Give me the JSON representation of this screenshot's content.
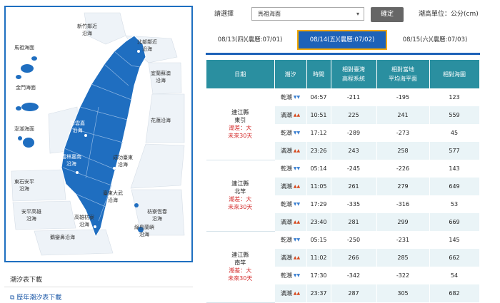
{
  "map": {
    "zones": [
      {
        "name": "新竹鄰近",
        "sub": "沿海"
      },
      {
        "name": "馬祖海面",
        "sub": ""
      },
      {
        "name": "北部鄰近",
        "sub": "沿海"
      },
      {
        "name": "宜蘭蘇澳",
        "sub": "沿海"
      },
      {
        "name": "金門海面",
        "sub": ""
      },
      {
        "name": "彰雲嘉",
        "sub": "沿海"
      },
      {
        "name": "花蓮沿海",
        "sub": ""
      },
      {
        "name": "澎湖海面",
        "sub": ""
      },
      {
        "name": "雲林嘉南",
        "sub": "沿海"
      },
      {
        "name": "成功臺東",
        "sub": "沿海"
      },
      {
        "name": "東石安平",
        "sub": "沿海"
      },
      {
        "name": "安平高雄",
        "sub": "沿海"
      },
      {
        "name": "臺東大武",
        "sub": "沿海"
      },
      {
        "name": "高雄枋寮",
        "sub": "沿海"
      },
      {
        "name": "枋寮恆春",
        "sub": "沿海"
      },
      {
        "name": "綠島蘭嶼",
        "sub": "沿海"
      },
      {
        "name": "鵝鑾鼻沿海",
        "sub": ""
      }
    ]
  },
  "download": {
    "title": "潮汐表下載",
    "link": "歷年潮汐表下載"
  },
  "controls": {
    "select_label": "請選擇",
    "station": "馬祖海面",
    "confirm": "確定",
    "unit": "潮高單位：公分(cm)"
  },
  "tabs": [
    {
      "label": "08/13(四)(農曆:07/01)",
      "active": false
    },
    {
      "label": "08/14(五)(農曆:07/02)",
      "active": true
    },
    {
      "label": "08/15(六)(農曆:07/03)",
      "active": false
    }
  ],
  "table": {
    "headers": [
      "日期",
      "潮汐",
      "時間",
      "相對臺灣\n高程系統",
      "相對當地\n平均海平面",
      "相對海圖"
    ],
    "groups": [
      {
        "county": "連江縣",
        "place": "東引",
        "range": "潮差：大",
        "days": "未來30天",
        "rows": [
          {
            "tide": "乾潮",
            "kind": "low",
            "time": "04:57",
            "twvd": "-211",
            "msl": "-195",
            "chart": "123"
          },
          {
            "tide": "滿潮",
            "kind": "high",
            "time": "10:51",
            "twvd": "225",
            "msl": "241",
            "chart": "559"
          },
          {
            "tide": "乾潮",
            "kind": "low",
            "time": "17:12",
            "twvd": "-289",
            "msl": "-273",
            "chart": "45"
          },
          {
            "tide": "滿潮",
            "kind": "high",
            "time": "23:26",
            "twvd": "243",
            "msl": "258",
            "chart": "577"
          }
        ]
      },
      {
        "county": "連江縣",
        "place": "北竿",
        "range": "潮差：大",
        "days": "未來30天",
        "rows": [
          {
            "tide": "乾潮",
            "kind": "low",
            "time": "05:14",
            "twvd": "-245",
            "msl": "-226",
            "chart": "143"
          },
          {
            "tide": "滿潮",
            "kind": "high",
            "time": "11:05",
            "twvd": "261",
            "msl": "279",
            "chart": "649"
          },
          {
            "tide": "乾潮",
            "kind": "low",
            "time": "17:29",
            "twvd": "-335",
            "msl": "-316",
            "chart": "53"
          },
          {
            "tide": "滿潮",
            "kind": "high",
            "time": "23:40",
            "twvd": "281",
            "msl": "299",
            "chart": "669"
          }
        ]
      },
      {
        "county": "連江縣",
        "place": "南竿",
        "range": "潮差：大",
        "days": "未來30天",
        "rows": [
          {
            "tide": "乾潮",
            "kind": "low",
            "time": "05:15",
            "twvd": "-250",
            "msl": "-231",
            "chart": "145"
          },
          {
            "tide": "滿潮",
            "kind": "high",
            "time": "11:02",
            "twvd": "266",
            "msl": "285",
            "chart": "662"
          },
          {
            "tide": "乾潮",
            "kind": "low",
            "time": "17:30",
            "twvd": "-342",
            "msl": "-322",
            "chart": "54"
          },
          {
            "tide": "滿潮",
            "kind": "high",
            "time": "23:37",
            "twvd": "287",
            "msl": "305",
            "chart": "682"
          }
        ]
      }
    ]
  },
  "colors": {
    "accent": "#1e62b8",
    "header": "#2a8fa0",
    "tab_border": "#f2a800",
    "warn": "#d42b2b"
  }
}
